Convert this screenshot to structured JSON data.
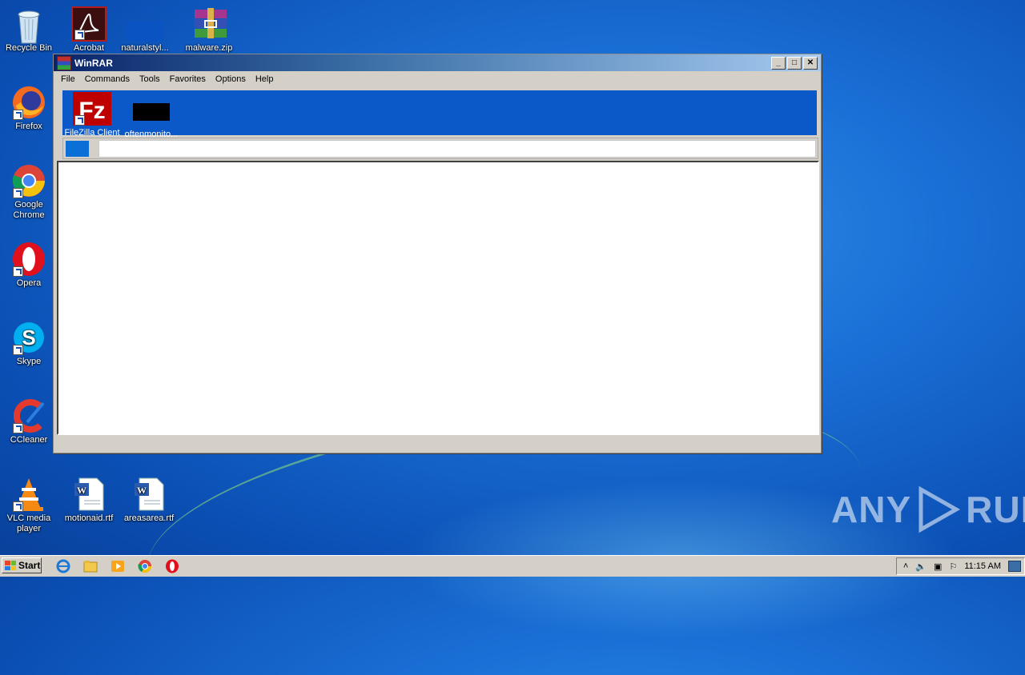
{
  "desktop": {
    "icons": [
      {
        "label": "Recycle Bin",
        "icon": "recycle-bin-icon"
      },
      {
        "label": "Acrobat",
        "icon": "acrobat-icon"
      },
      {
        "label": "naturalstyl...",
        "icon": "blank-file-icon"
      },
      {
        "label": "malware.zip",
        "icon": "winrar-archive-icon"
      },
      {
        "label": "Firefox",
        "icon": "firefox-icon"
      },
      {
        "label": "Google Chrome",
        "icon": "chrome-icon"
      },
      {
        "label": "Opera",
        "icon": "opera-icon"
      },
      {
        "label": "Skype",
        "icon": "skype-icon"
      },
      {
        "label": "CCleaner",
        "icon": "ccleaner-icon"
      },
      {
        "label": "VLC media player",
        "icon": "vlc-icon"
      },
      {
        "label": "motionaid.rtf",
        "icon": "word-document-icon"
      },
      {
        "label": "areasarea.rtf",
        "icon": "word-document-icon"
      }
    ]
  },
  "winrar": {
    "title": "WinRAR",
    "menu": [
      "File",
      "Commands",
      "Tools",
      "Favorites",
      "Options",
      "Help"
    ],
    "toolbar_items": [
      {
        "label": "FileZilla Client",
        "icon": "filezilla-icon"
      },
      {
        "label": "oftenmonito...",
        "icon": "black-thumbnail-icon"
      }
    ],
    "accent": "#0b58c8"
  },
  "taskbar": {
    "start_label": "Start",
    "quick_launch": [
      "internet-explorer-icon",
      "explorer-folder-icon",
      "media-player-icon",
      "chrome-icon",
      "opera-icon"
    ],
    "clock": "11:15 AM"
  },
  "watermark": {
    "left": "ANY",
    "right": "RUN"
  }
}
